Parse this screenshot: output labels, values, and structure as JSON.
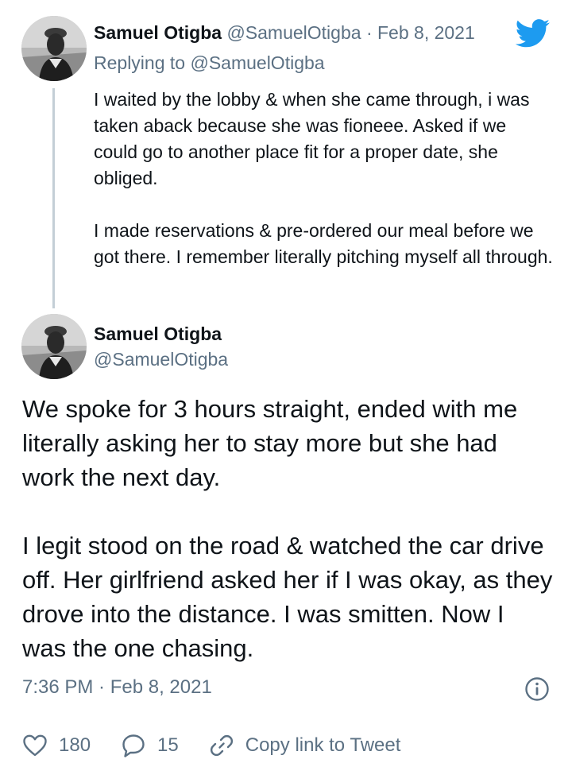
{
  "parent_tweet": {
    "author_name": "Samuel Otigba",
    "author_handle": "@SamuelOtigba",
    "separator": "·",
    "date": "Feb 8, 2021",
    "replying_prefix": "Replying to",
    "replying_handle": "@SamuelOtigba",
    "paragraphs": [
      "I waited by the lobby & when she came through, i was taken aback because she was fioneee. Asked if we could go to another place fit for a proper date, she obliged.",
      "I made reservations & pre-ordered our meal before we got there. I remember literally pitching myself all through."
    ],
    "avatar_icon": "avatar-photo",
    "brand_icon": "twitter-bird-icon",
    "brand_color": "#1d9bf0"
  },
  "main_tweet": {
    "author_name": "Samuel Otigba",
    "author_handle": "@SamuelOtigba",
    "paragraphs": [
      "We spoke for 3 hours straight, ended with me literally asking her to stay more but she had work the next day.",
      "I legit stood on the road & watched the car drive off. Her girlfriend asked her if I was okay, as they drove into the distance. I was smitten. Now I was the one chasing."
    ],
    "timestamp": "7:36 PM · Feb 8, 2021",
    "info_icon": "info-icon",
    "actions": {
      "like_count": "180",
      "reply_count": "15",
      "copy_link_label": "Copy link to Tweet"
    }
  },
  "colors": {
    "text": "#0f1419",
    "secondary_text": "#5b7083",
    "thread_line": "#c4cfd6",
    "background": "#ffffff"
  }
}
